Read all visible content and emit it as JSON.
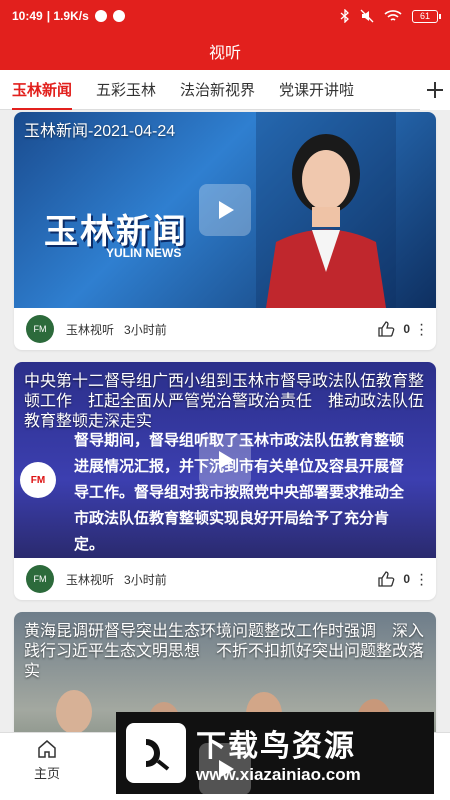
{
  "status_bar": {
    "time": "10:49",
    "speed": "| 1.9K/s",
    "battery": "61"
  },
  "header": {
    "title": "视听"
  },
  "tabs": [
    {
      "label": "玉林新闻",
      "active": true
    },
    {
      "label": "五彩玉林",
      "active": false
    },
    {
      "label": "法治新视界",
      "active": false
    },
    {
      "label": "党课开讲啦",
      "active": false
    }
  ],
  "add_tab_icon": "plus-icon",
  "feed": [
    {
      "headline": "玉林新闻-2021-04-24",
      "logo_text": "玉林新闻",
      "logo_sub": "YULIN NEWS",
      "source": "玉林视听",
      "time_ago": "3小时前",
      "likes": "0"
    },
    {
      "headline": "中央第十二督导组广西小组到玉林市督导政法队伍教育整顿工作　扛起全面从严管党治警政治责任　推动政法队伍教育整顿走深走实",
      "caption": "督导期间，督导组听取了玉林市政法队伍教育整顿进展情况汇报，并下沉到市有关单位及容县开展督导工作。督导组对我市按照党中央部署要求推动全市政法队伍教育整顿实现良好开局给予了充分肯定。",
      "badge": "FM",
      "source": "玉林视听",
      "time_ago": "3小时前",
      "likes": "0"
    },
    {
      "headline": "黄海昆调研督导突出生态环境问题整改工作时强调　深入践行习近平生态文明思想　不折不扣抓好突出问题整改落实",
      "source": "",
      "time_ago": "",
      "likes": ""
    }
  ],
  "bottom_nav": {
    "home_label": "主页"
  },
  "watermark": {
    "title": "下载鸟资源",
    "url": "www.xiazainiao.com"
  },
  "colors": {
    "brand_red": "#e2201d"
  }
}
